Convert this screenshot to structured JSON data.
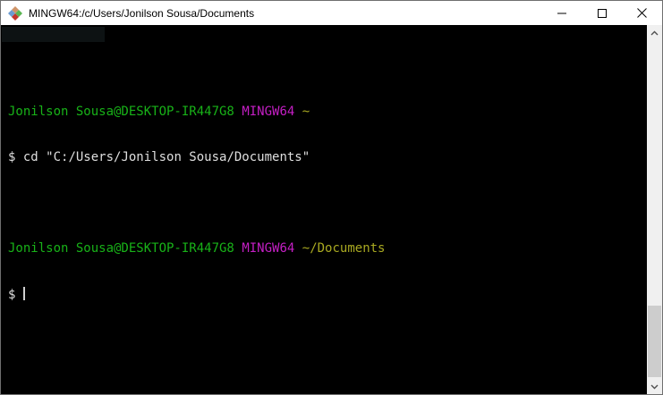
{
  "theme": {
    "titlebar_bg": "#ffffff",
    "title_fg": "#000000",
    "terminal_bg": "#000000",
    "terminal_fg": "#dfdfdf",
    "ansi_green": "#18b218",
    "ansi_magenta": "#c51fc5",
    "ansi_yellow": "#a9a921"
  },
  "titlebar": {
    "title": "MINGW64:/c/Users/Jonilson Sousa/Documents",
    "icon": "git-bash-icon"
  },
  "window_controls": {
    "minimize": "minimize",
    "maximize": "maximize",
    "close": "close"
  },
  "terminal": {
    "prompt_symbol": "$",
    "blocks": [
      {
        "user_host": "Jonilson Sousa@DESKTOP-IR447G8",
        "env": "MINGW64",
        "path": "~",
        "command": "cd \"C:/Users/Jonilson Sousa/Documents\""
      },
      {
        "user_host": "Jonilson Sousa@DESKTOP-IR447G8",
        "env": "MINGW64",
        "path": "~/Documents",
        "command": ""
      }
    ],
    "cursor_visible": true
  },
  "scrollbar": {
    "up_arrow": "chevron-up",
    "down_arrow": "chevron-down"
  }
}
